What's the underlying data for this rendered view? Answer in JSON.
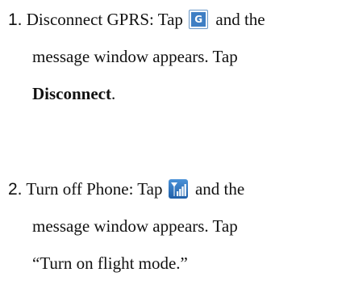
{
  "steps": [
    {
      "number": "1.",
      "line1_before_icon": "Disconnect GPRS: Tap",
      "icon": "gprs-g-icon",
      "line1_after_icon": "and the",
      "line2": "message window appears. Tap",
      "line3_bold": "Disconnect",
      "line3_after": "."
    },
    {
      "number": "2.",
      "line1_before_icon": "Turn off Phone: Tap",
      "icon": "signal-strength-icon",
      "line1_after_icon": "and the",
      "line2": "message window appears. Tap",
      "line3": "“Turn on flight mode.”"
    }
  ],
  "colors": {
    "text": "#111111",
    "gprs_icon_fill": "#3f7fc4",
    "gprs_icon_border": "#6a98c8",
    "signal_icon_fill": "#2f74c0"
  }
}
